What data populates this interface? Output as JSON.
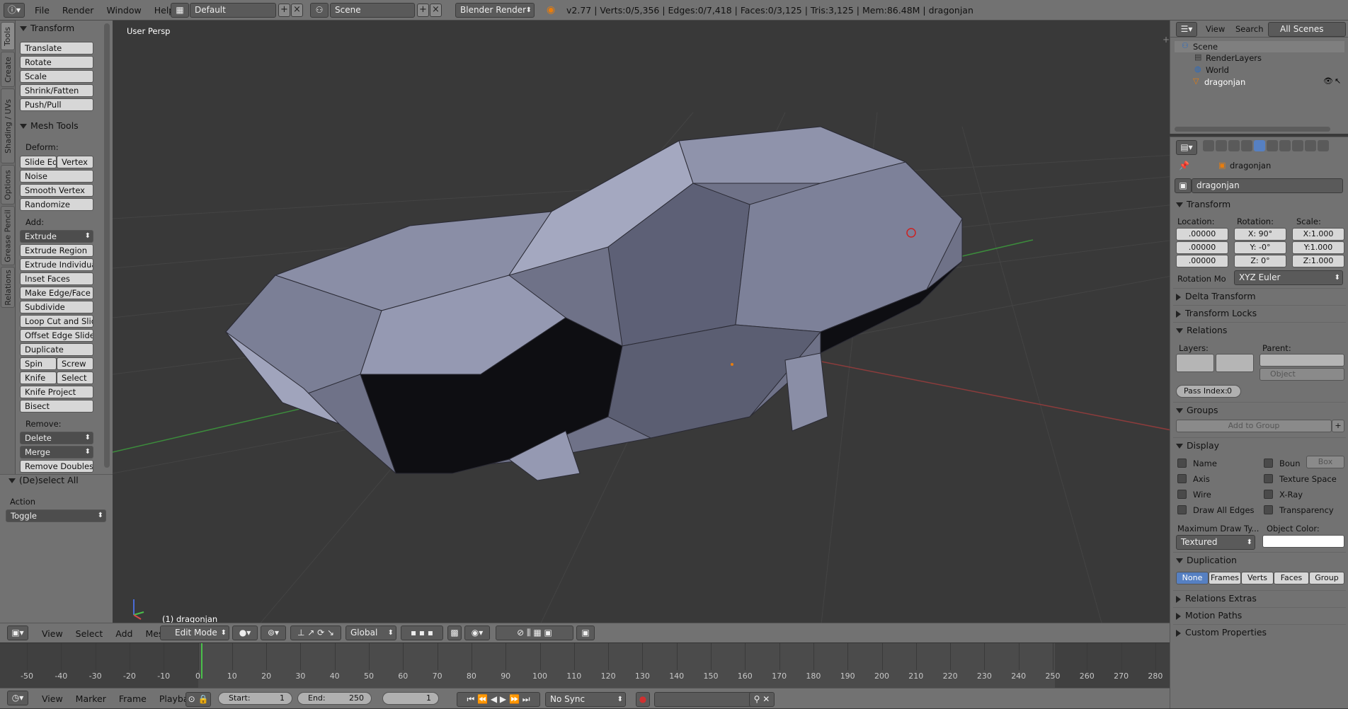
{
  "topbar": {
    "info_icon": "info-icon",
    "menus": [
      "File",
      "Render",
      "Window",
      "Help"
    ],
    "layout": "Default",
    "scene": "Scene",
    "engine": "Blender Render",
    "stats": "v2.77 | Verts:0/5,356 | Edges:0/7,418 | Faces:0/3,125 | Tris:3,125 | Mem:86.48M | dragonjan"
  },
  "shelf_tabs": [
    "Tools",
    "Create",
    "Shading / UVs",
    "Options",
    "Grease Pencil",
    "Relations"
  ],
  "transform": {
    "title": "Transform",
    "buttons": [
      "Translate",
      "Rotate",
      "Scale",
      "Shrink/Fatten",
      "Push/Pull"
    ]
  },
  "mesh_tools": {
    "title": "Mesh Tools",
    "deform_label": "Deform:",
    "slide_edge": "Slide Ed",
    "vertex": "Vertex",
    "deform": [
      "Noise",
      "Smooth Vertex",
      "Randomize"
    ],
    "add_label": "Add:",
    "extrude": "Extrude",
    "add": [
      "Extrude Region",
      "Extrude Individual",
      "Inset Faces",
      "Make Edge/Face",
      "Subdivide",
      "Loop Cut and Slide",
      "Offset Edge Slide",
      "Duplicate"
    ],
    "spin": "Spin",
    "screw": "Screw",
    "knife": "Knife",
    "select": "Select",
    "knife_project": "Knife Project",
    "bisect": "Bisect",
    "remove_label": "Remove:",
    "delete": "Delete",
    "merge": "Merge",
    "remove_doubles": "Remove Doubles"
  },
  "operator": {
    "title": "(De)select All",
    "action_label": "Action",
    "action_value": "Toggle"
  },
  "viewport": {
    "view_label": "User Persp",
    "object_label": "(1) dragonjan"
  },
  "view3d_header": {
    "menus": [
      "View",
      "Select",
      "Add",
      "Mesh"
    ],
    "mode": "Edit Mode",
    "orientation": "Global"
  },
  "timeline": {
    "ticks": [
      "-50",
      "-40",
      "-30",
      "-20",
      "-10",
      "0",
      "10",
      "20",
      "30",
      "40",
      "50",
      "60",
      "70",
      "80",
      "90",
      "100",
      "110",
      "120",
      "130",
      "140",
      "150",
      "160",
      "170",
      "180",
      "190",
      "200",
      "210",
      "220",
      "230",
      "240",
      "250",
      "260",
      "270",
      "280"
    ],
    "menus": [
      "View",
      "Marker",
      "Frame",
      "Playback"
    ],
    "start_label": "Start:",
    "start": "1",
    "end_label": "End:",
    "end": "250",
    "current": "1",
    "sync": "No Sync"
  },
  "outliner": {
    "menus": [
      "View",
      "Search"
    ],
    "filter": "All Scenes",
    "items": [
      "Scene",
      "RenderLayers",
      "World",
      "dragonjan"
    ]
  },
  "properties": {
    "object_name": "dragonjan",
    "breadcrumb": "dragonjan",
    "transform_title": "Transform",
    "location_label": "Location:",
    "rotation_label": "Rotation:",
    "scale_label": "Scale:",
    "location": [
      ".00000",
      ".00000",
      ".00000"
    ],
    "rotation": [
      "X:",
      "Y:",
      "Z:"
    ],
    "rotation_vals": [
      "90°",
      "-0°",
      "0°"
    ],
    "scale": [
      "X:1.000",
      "Y:1.000",
      "Z:1.000"
    ],
    "rotation_mode_label": "Rotation Mo",
    "rotation_mode": "XYZ Euler",
    "delta_title": "Delta Transform",
    "locks_title": "Transform Locks",
    "relations_title": "Relations",
    "layers_label": "Layers:",
    "parent_label": "Parent:",
    "parent_type": "Object",
    "pass_index_label": "Pass Index:",
    "pass_index": "0",
    "groups_title": "Groups",
    "add_to_group": "Add to Group",
    "display_title": "Display",
    "display_left": [
      "Name",
      "Axis",
      "Wire",
      "Draw All Edges"
    ],
    "display_right": [
      "Boun",
      "Texture Space",
      "X-Ray",
      "Transparency"
    ],
    "bounds_type": "Box",
    "max_draw_label": "Maximum Draw Ty...",
    "max_draw": "Textured",
    "object_color_label": "Object Color:",
    "duplication_title": "Duplication",
    "dup_options": [
      "None",
      "Frames",
      "Verts",
      "Faces",
      "Group"
    ],
    "dup_selected": "None",
    "relations_extras": "Relations Extras",
    "motion_paths": "Motion Paths",
    "custom_properties": "Custom Properties"
  },
  "colors": {
    "accent": "#5680c2",
    "panel": "#727272",
    "viewport": "#393939",
    "mesh": "#7c7f95",
    "object_color": "#ffffff"
  }
}
